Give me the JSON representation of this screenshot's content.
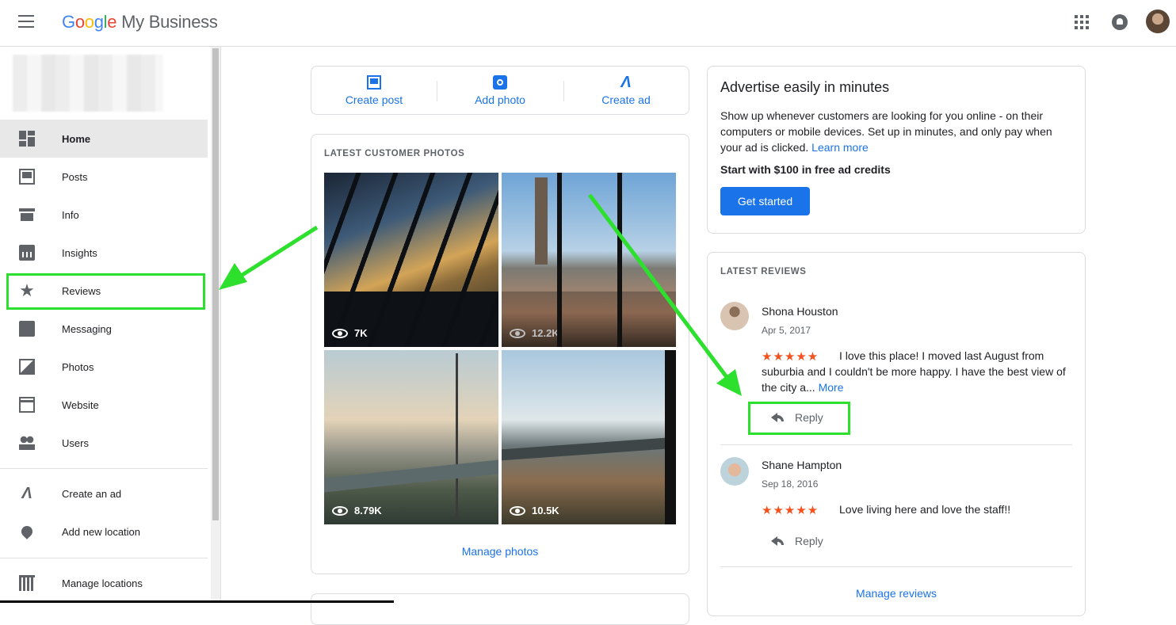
{
  "header": {
    "logo_google": [
      "G",
      "o",
      "o",
      "g",
      "l",
      "e"
    ],
    "logo_product": "My Business"
  },
  "sidebar": {
    "items": [
      {
        "label": "Home",
        "icon": "dashboard-icon"
      },
      {
        "label": "Posts",
        "icon": "posts-icon"
      },
      {
        "label": "Info",
        "icon": "storefront-icon"
      },
      {
        "label": "Insights",
        "icon": "insights-icon"
      },
      {
        "label": "Reviews",
        "icon": "star-icon"
      },
      {
        "label": "Messaging",
        "icon": "chat-icon"
      },
      {
        "label": "Photos",
        "icon": "photos-icon"
      },
      {
        "label": "Website",
        "icon": "website-icon"
      },
      {
        "label": "Users",
        "icon": "users-icon"
      }
    ],
    "secondary": [
      {
        "label": "Create an ad",
        "icon": "ads-icon"
      },
      {
        "label": "Add new location",
        "icon": "add-location-icon"
      }
    ],
    "manage": {
      "label": "Manage locations",
      "icon": "building-icon"
    },
    "active": "Home"
  },
  "actions": [
    {
      "label": "Create post",
      "icon": "post-icon"
    },
    {
      "label": "Add photo",
      "icon": "add-photo-icon"
    },
    {
      "label": "Create ad",
      "icon": "ads-icon"
    }
  ],
  "photos": {
    "title": "LATEST CUSTOMER PHOTOS",
    "items": [
      {
        "views": "7K"
      },
      {
        "views": "12.2K"
      },
      {
        "views": "8.79K"
      },
      {
        "views": "10.5K"
      }
    ],
    "manage_label": "Manage photos"
  },
  "ad_card": {
    "title": "Advertise easily in minutes",
    "body": "Show up whenever customers are looking for you online - on their computers or mobile devices. Set up in minutes, and only pay when your ad is clicked.",
    "learn_more": "Learn more",
    "credit": "Start with $100 in free ad credits",
    "button": "Get started"
  },
  "reviews": {
    "title": "LATEST REVIEWS",
    "items": [
      {
        "name": "Shona Houston",
        "date": "Apr 5, 2017",
        "stars": "★★★★★",
        "rating": 5,
        "text": "I love this place! I moved last August from suburbia and I couldn't be more happy. I have the best view of the city a...",
        "more": "More",
        "reply": "Reply"
      },
      {
        "name": "Shane Hampton",
        "date": "Sep 18, 2016",
        "stars": "★★★★★",
        "rating": 5,
        "text": "Love living here and love the staff!!",
        "reply": "Reply"
      }
    ],
    "manage_label": "Manage reviews"
  },
  "colors": {
    "accent": "#1a73e8",
    "star": "#f4511e",
    "highlight": "#2ee02e"
  }
}
